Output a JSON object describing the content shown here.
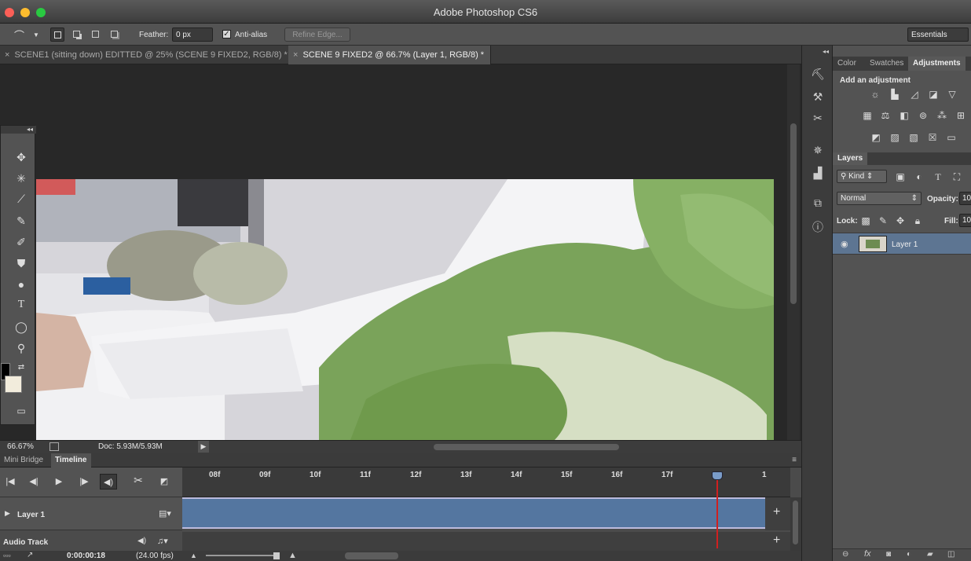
{
  "window": {
    "title": "Adobe Photoshop CS6"
  },
  "options_bar": {
    "feather_label": "Feather:",
    "feather_value": "0 px",
    "antialias_label": "Anti-alias",
    "refine_edge": "Refine Edge...",
    "workspace": "Essentials"
  },
  "doc_tabs": [
    {
      "label": "SCENE1 (sitting down) EDITTED @ 25% (SCENE 9 FIXED2, RGB/8) *"
    },
    {
      "label": "SCENE 9 FIXED2 @ 66.7% (Layer 1, RGB/8) *"
    }
  ],
  "status": {
    "zoom": "66.67%",
    "doc": "Doc: 5.93M/5.93M"
  },
  "timeline": {
    "tabs": [
      "Mini Bridge",
      "Timeline"
    ],
    "ruler": [
      "08f",
      "09f",
      "10f",
      "11f",
      "12f",
      "13f",
      "14f",
      "15f",
      "16f",
      "17f",
      "1"
    ],
    "layer_track": "Layer 1",
    "audio_track": "Audio Track",
    "timecode": "0:00:00:18",
    "fps": "(24.00 fps)"
  },
  "right_panel": {
    "tabs": [
      "Color",
      "Swatches",
      "Adjustments"
    ],
    "adjust_title": "Add an adjustment",
    "layers_tab": "Layers",
    "kind": "Kind",
    "blend_mode": "Normal",
    "opacity_label": "Opacity:",
    "opacity_value": "10",
    "lock_label": "Lock:",
    "fill_label": "Fill:",
    "fill_value": "10",
    "layer_name": "Layer 1"
  },
  "colors": {
    "accent_clip": "#5476a0",
    "playhead": "#d02020",
    "selected_layer": "#5d7592"
  }
}
